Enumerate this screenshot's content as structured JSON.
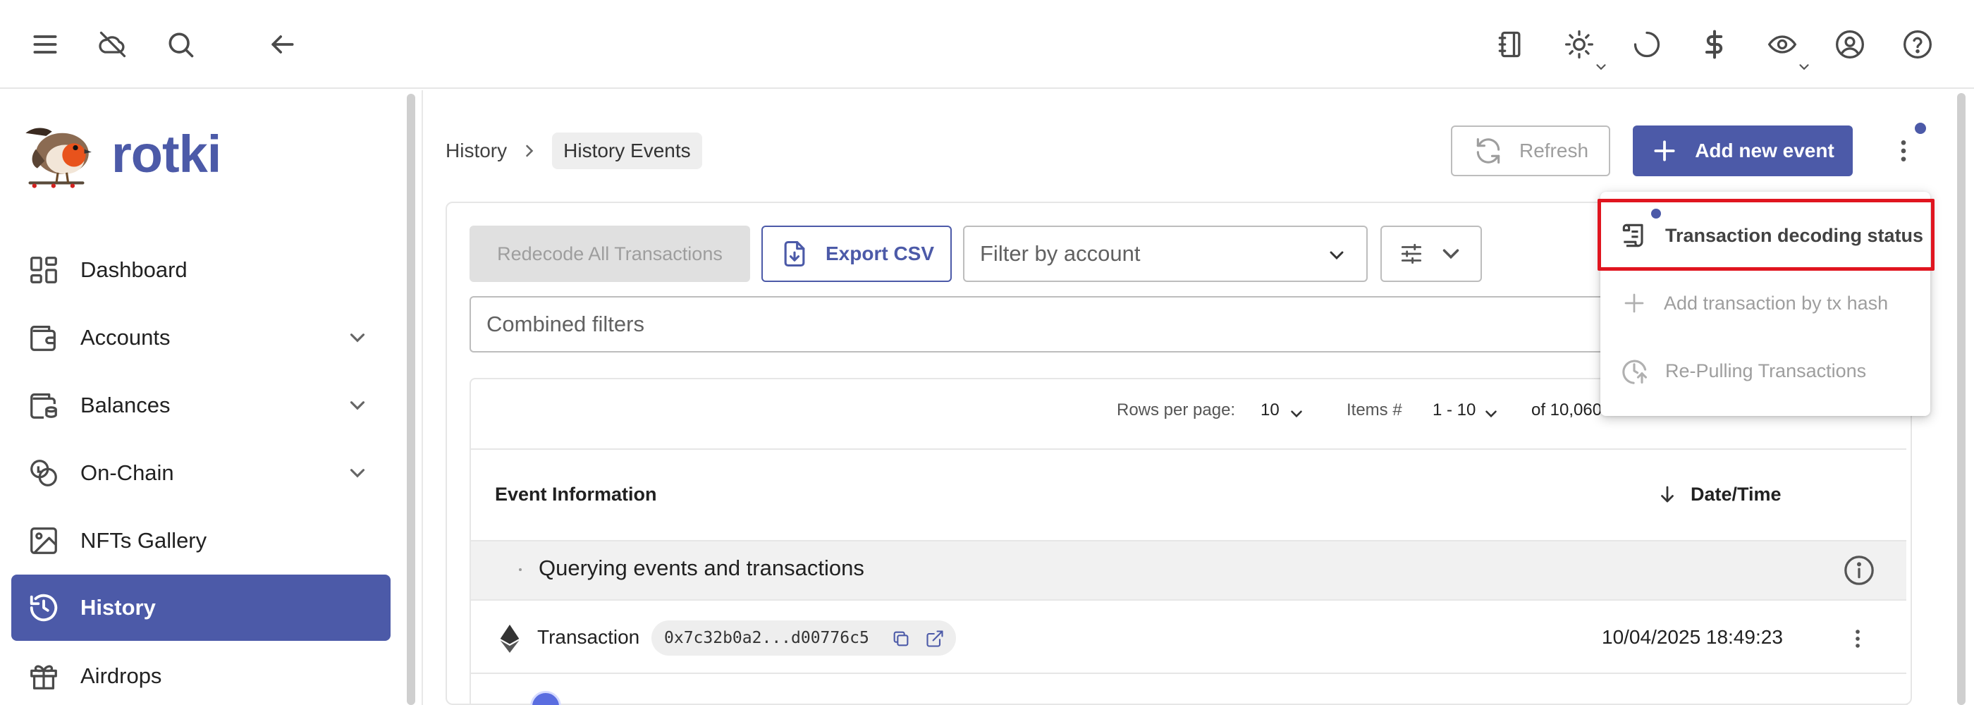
{
  "app": {
    "name": "rotki"
  },
  "sidebar": {
    "items": [
      {
        "label": "Dashboard",
        "icon": "dashboard-icon",
        "expandable": false
      },
      {
        "label": "Accounts",
        "icon": "wallet-icon",
        "expandable": true
      },
      {
        "label": "Balances",
        "icon": "balances-icon",
        "expandable": true
      },
      {
        "label": "On-Chain",
        "icon": "coins-icon",
        "expandable": true
      },
      {
        "label": "NFTs Gallery",
        "icon": "image-icon",
        "expandable": false
      },
      {
        "label": "History",
        "icon": "history-icon",
        "expandable": false,
        "active": true
      },
      {
        "label": "Airdrops",
        "icon": "gift-icon",
        "expandable": false
      }
    ]
  },
  "breadcrumb": {
    "parent": "History",
    "current": "History Events"
  },
  "toolbar": {
    "refresh_label": "Refresh",
    "add_event_label": "Add new event"
  },
  "filters": {
    "redecode_label": "Redecode All Transactions",
    "export_label": "Export CSV",
    "account_placeholder": "Filter by account",
    "combined_placeholder": "Combined filters"
  },
  "table": {
    "rows_per_page_label": "Rows per page:",
    "rows_per_page_value": "10",
    "items_label": "Items #",
    "items_range": "1 - 10",
    "of_total": "of 10,060",
    "columns": {
      "event_info": "Event Information",
      "date_time": "Date/Time"
    },
    "group_title": "Querying events and transactions",
    "rows": [
      {
        "type": "Transaction",
        "hash": "0x7c32b0a2...d00776c5",
        "date": "10/04/2025 18:49:23"
      }
    ]
  },
  "menu": {
    "items": [
      {
        "label": "Transaction decoding status",
        "enabled": true,
        "highlighted": true
      },
      {
        "label": "Add transaction by tx hash",
        "enabled": false
      },
      {
        "label": "Re-Pulling Transactions",
        "enabled": false
      }
    ]
  },
  "colors": {
    "primary": "#4c5aa8",
    "highlight": "#e0151f",
    "muted": "#9e9e9e"
  }
}
